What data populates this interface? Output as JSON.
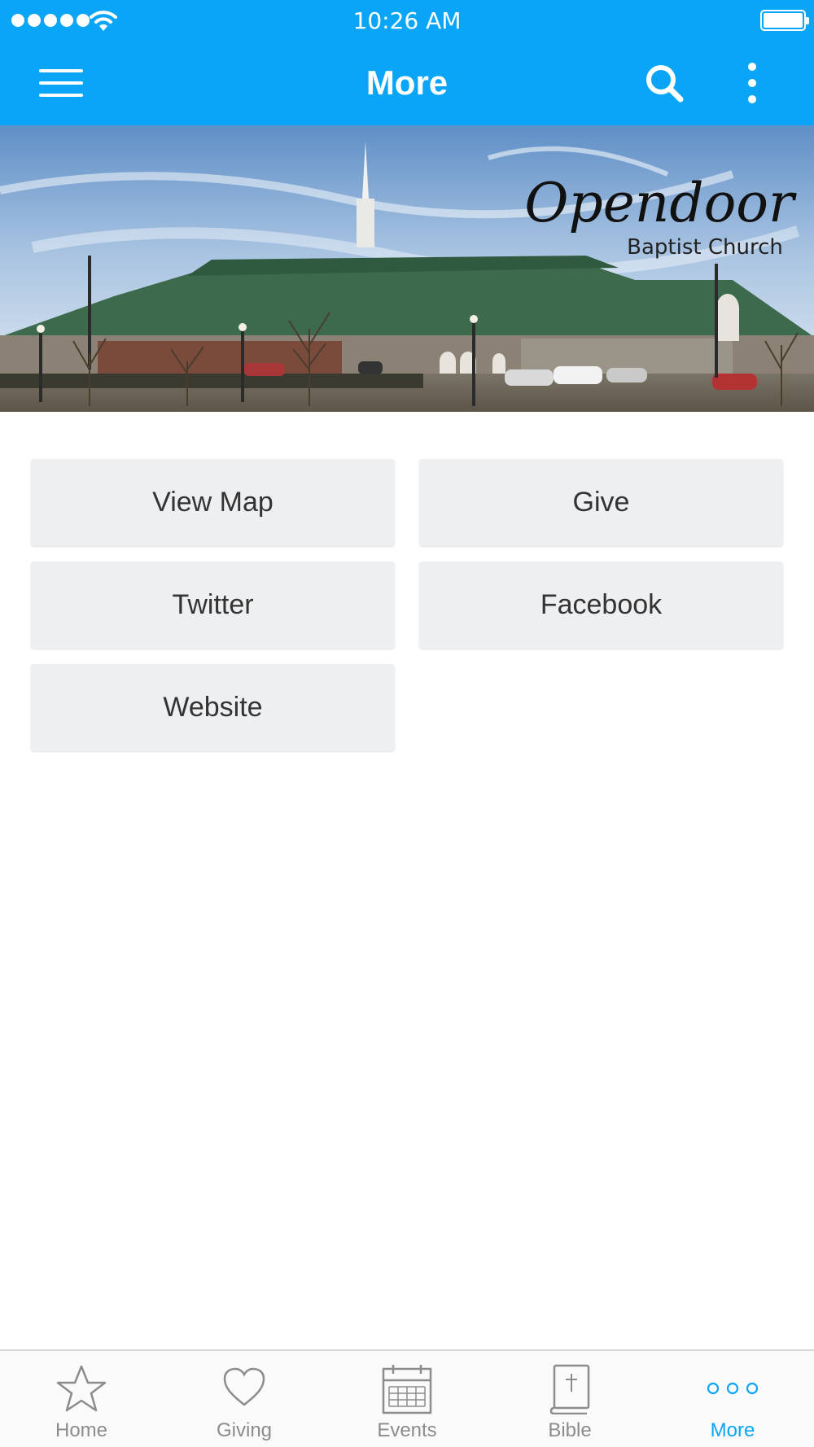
{
  "status_bar": {
    "time": "10:26 AM"
  },
  "header": {
    "title": "More"
  },
  "hero": {
    "logo_script": "Opendoor",
    "logo_subtitle": "Baptist Church"
  },
  "grid": {
    "buttons": [
      "View Map",
      "Give",
      "Twitter",
      "Facebook",
      "Website"
    ]
  },
  "tabs": [
    {
      "label": "Home",
      "icon": "star-icon"
    },
    {
      "label": "Giving",
      "icon": "heart-icon"
    },
    {
      "label": "Events",
      "icon": "calendar-icon"
    },
    {
      "label": "Bible",
      "icon": "bible-icon"
    },
    {
      "label": "More",
      "icon": "more-dots-icon",
      "active": true
    }
  ],
  "colors": {
    "accent": "#0aa5f7",
    "button_bg": "#eeeff1",
    "tab_inactive": "#8c8c8c"
  }
}
